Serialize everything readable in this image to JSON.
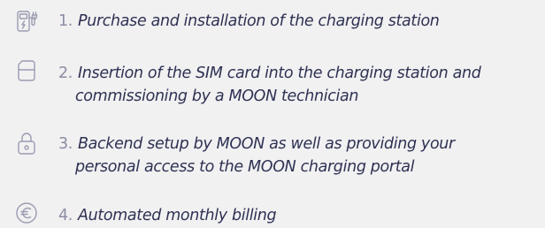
{
  "steps": [
    {
      "number": "1.",
      "icon": "charging-station-icon",
      "lines": [
        "Purchase and installation of the charging station"
      ]
    },
    {
      "number": "2.",
      "icon": "sim-card-icon",
      "lines": [
        "Insertion of the SIM card into the charging station and",
        "commissioning by a MOON technician"
      ]
    },
    {
      "number": "3.",
      "icon": "lock-icon",
      "lines": [
        "Backend setup by MOON as well as providing your",
        "personal access to the MOON charging portal"
      ]
    },
    {
      "number": "4.",
      "icon": "euro-icon",
      "lines": [
        "Automated monthly billing"
      ]
    }
  ],
  "colors": {
    "background": "#f1f1f2",
    "text": "#2e3152",
    "number": "#8b8da2",
    "icon": "#9a9cb0"
  }
}
